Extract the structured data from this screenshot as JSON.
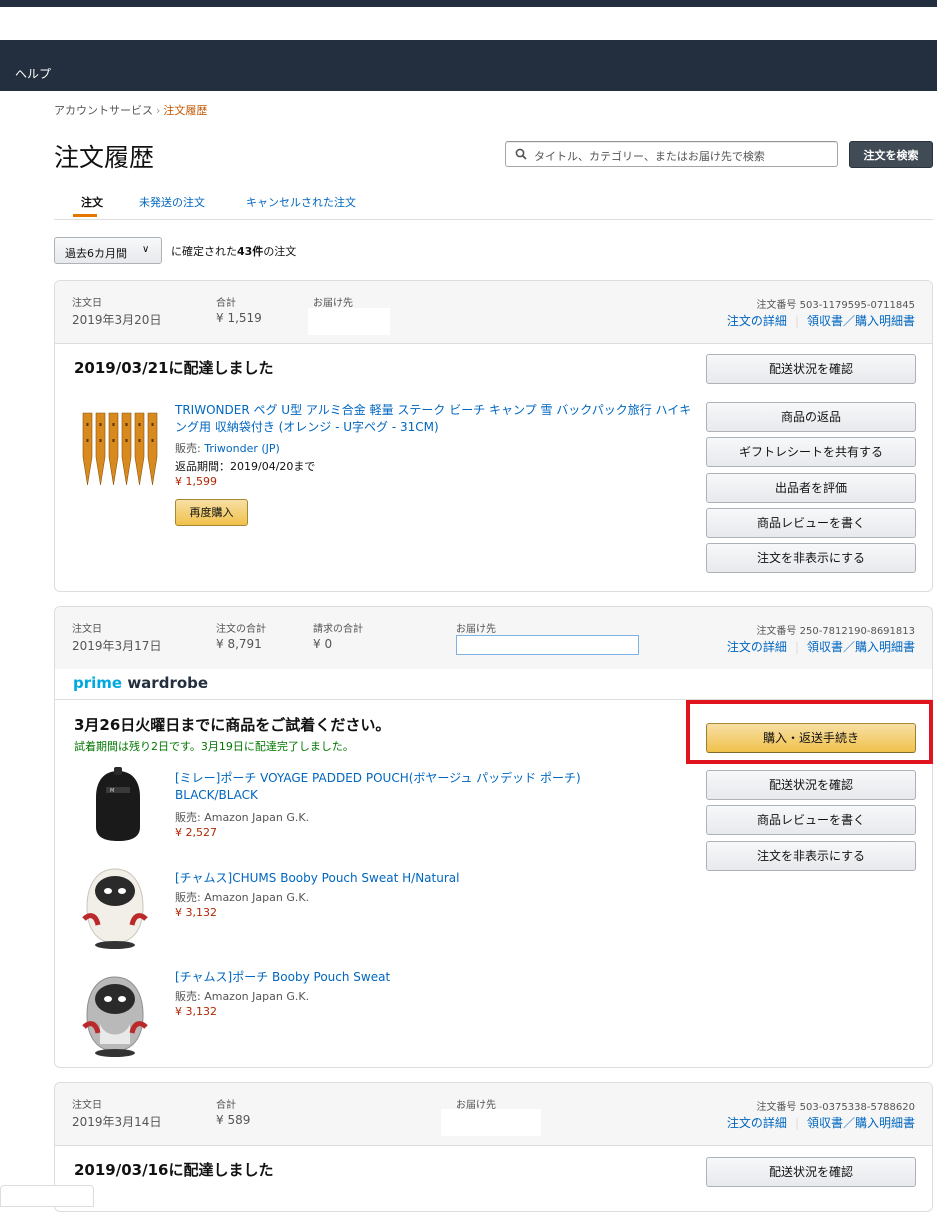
{
  "nav": {
    "help": "ヘルプ"
  },
  "breadcrumb": {
    "parent": "アカウントサービス",
    "separator": "›",
    "current": "注文履歴"
  },
  "page": {
    "title": "注文履歴"
  },
  "search": {
    "placeholder": "タイトル、カテゴリー、またはお届け先で検索",
    "button": "注文を検索"
  },
  "tabs": [
    "注文",
    "未発送の注文",
    "キャンセルされた注文"
  ],
  "filter": {
    "selected": "過去6カ月間",
    "prefix": "に確定された",
    "count": "43件",
    "suffix": "の注文"
  },
  "orders": [
    {
      "date_label": "注文日",
      "date": "2019年3月20日",
      "total_label": "合計",
      "total": "¥ 1,519",
      "ship_label": "お届け先",
      "order_no": "注文番号 503-1179595-0711845",
      "details_link": "注文の詳細",
      "receipt_link": "領収書／購入明細書",
      "status": "2019/03/21に配達しました",
      "item": {
        "title": "TRIWONDER ペグ U型 アルミ合金 軽量 ステーク ビーチ キャンプ 雪 バックパック旅行 ハイキング用 収納袋付き (オレンジ - U字ペグ - 31CM)",
        "seller_prefix": "販売:",
        "seller": "Triwonder (JP)",
        "return": "返品期間：2019/04/20まで",
        "price": "¥ 1,599",
        "rebuy": "再度購入"
      },
      "buttons": [
        "配送状況を確認",
        "商品の返品",
        "ギフトレシートを共有する",
        "出品者を評価",
        "商品レビューを書く",
        "注文を非表示にする"
      ]
    },
    {
      "date_label": "注文日",
      "date": "2019年3月17日",
      "total_label": "注文の合計",
      "total": "¥ 8,791",
      "charge_label": "請求の合計",
      "charge": "¥ 0",
      "ship_label": "お届け先",
      "order_no": "注文番号 250-7812190-8691813",
      "details_link": "注文の詳細",
      "receipt_link": "領収書／購入明細書",
      "prime_brand": "prime",
      "prime_word": "wardrobe",
      "status": "3月26日火曜日までに商品をご試着ください。",
      "substatus": "試着期間は残り2日です。3月19日に配達完了しました。",
      "items": [
        {
          "title": "[ミレー]ポーチ VOYAGE PADDED POUCH(ボヤージュ パッデッド ポーチ) BLACK/BLACK",
          "seller": "販売: Amazon Japan G.K.",
          "price": "¥ 2,527"
        },
        {
          "title": "[チャムス]CHUMS Booby Pouch Sweat H/Natural",
          "seller": "販売: Amazon Japan G.K.",
          "price": "¥ 3,132"
        },
        {
          "title": "[チャムス]ポーチ Booby Pouch Sweat",
          "seller": "販売: Amazon Japan G.K.",
          "price": "¥ 3,132"
        }
      ],
      "buttons": [
        "購入・返送手続き",
        "配送状況を確認",
        "商品レビューを書く",
        "注文を非表示にする"
      ]
    },
    {
      "date_label": "注文日",
      "date": "2019年3月14日",
      "total_label": "合計",
      "total": "¥ 589",
      "ship_label": "お届け先",
      "order_no": "注文番号 503-0375338-5788620",
      "details_link": "注文の詳細",
      "receipt_link": "領収書／購入明細書",
      "status": "2019/03/16に配達しました",
      "buttons": [
        "配送状況を確認"
      ]
    }
  ]
}
